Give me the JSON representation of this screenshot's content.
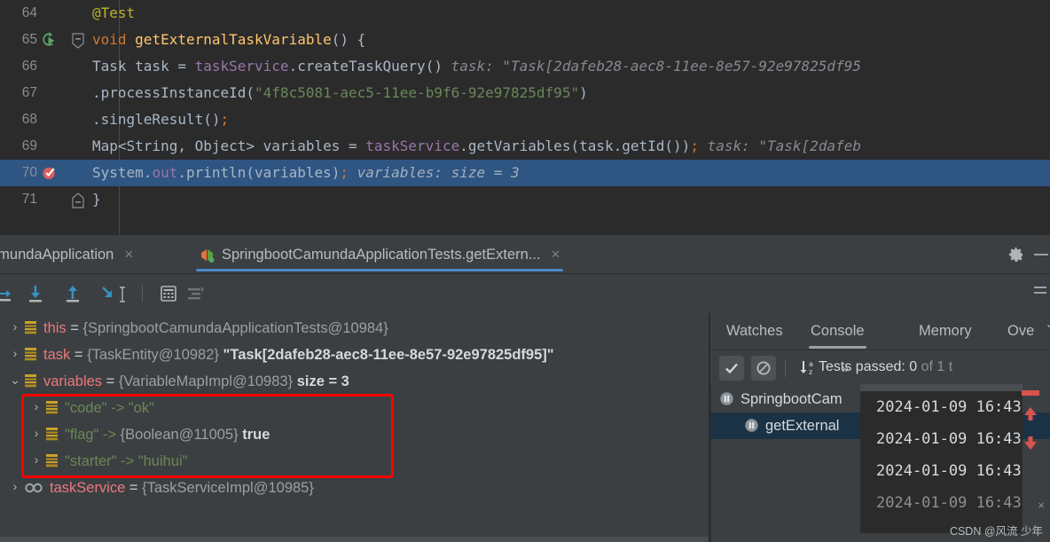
{
  "editor": {
    "lines": [
      {
        "number": "64",
        "gutter": "",
        "fold": false,
        "highlighted": false,
        "tokens": [
          {
            "text": "    ",
            "cls": "k-plain"
          },
          {
            "text": "@Test",
            "cls": "k-annot"
          }
        ]
      },
      {
        "number": "65",
        "gutter": "run-icon",
        "fold": true,
        "highlighted": false,
        "tokens": [
          {
            "text": "    ",
            "cls": "k-plain"
          },
          {
            "text": "void",
            "cls": "k-kw"
          },
          {
            "text": " ",
            "cls": "k-plain"
          },
          {
            "text": "getExternalTaskVariable",
            "cls": "k-meth"
          },
          {
            "text": "() {",
            "cls": "k-plain"
          }
        ]
      },
      {
        "number": "66",
        "gutter": "",
        "fold": false,
        "highlighted": false,
        "tokens": [
          {
            "text": "        Task task = ",
            "cls": "k-plain"
          },
          {
            "text": "taskService",
            "cls": "k-field"
          },
          {
            "text": ".createTaskQuery()",
            "cls": "k-plain"
          },
          {
            "text": "   task: \"Task[2dafeb28-aec8-11ee-8e57-92e97825df95",
            "cls": "k-hint"
          }
        ]
      },
      {
        "number": "67",
        "gutter": "",
        "fold": false,
        "highlighted": false,
        "tokens": [
          {
            "text": "                .processInstanceId(",
            "cls": "k-plain"
          },
          {
            "text": "\"4f8c5081-aec5-11ee-b9f6-92e97825df95\"",
            "cls": "k-str"
          },
          {
            "text": ")",
            "cls": "k-plain"
          }
        ]
      },
      {
        "number": "68",
        "gutter": "",
        "fold": false,
        "highlighted": false,
        "tokens": [
          {
            "text": "                .singleResult()",
            "cls": "k-plain"
          },
          {
            "text": ";",
            "cls": "k-semi"
          }
        ]
      },
      {
        "number": "69",
        "gutter": "",
        "fold": false,
        "highlighted": false,
        "tokens": [
          {
            "text": "        Map<String, Object> variables = ",
            "cls": "k-plain"
          },
          {
            "text": "taskService",
            "cls": "k-field"
          },
          {
            "text": ".getVariables(task.getId())",
            "cls": "k-plain"
          },
          {
            "text": ";",
            "cls": "k-semi"
          },
          {
            "text": "   task: \"Task[2dafeb",
            "cls": "k-hint"
          }
        ]
      },
      {
        "number": "70",
        "gutter": "breakpoint-verified-icon",
        "fold": false,
        "highlighted": true,
        "tokens": [
          {
            "text": "        System.",
            "cls": "k-plain"
          },
          {
            "text": "out",
            "cls": "k-field"
          },
          {
            "text": ".println(variables)",
            "cls": "k-plain"
          },
          {
            "text": ";",
            "cls": "k-semi"
          },
          {
            "text": "   variables:  size = 3",
            "cls": "k-hint-lt"
          }
        ]
      },
      {
        "number": "71",
        "gutter": "",
        "fold": true,
        "highlighted": false,
        "tokens": [
          {
            "text": "    }",
            "cls": "k-plain"
          }
        ]
      }
    ]
  },
  "tabbar": {
    "tabs": [
      {
        "label": "amundaApplication",
        "icon": "",
        "close": "×",
        "active": false
      },
      {
        "label": "SpringbootCamundaApplicationTests.getExtern...",
        "icon": "test-run-icon",
        "close": "×",
        "active": true
      }
    ],
    "settings_icon": "gear-icon",
    "hide_icon": "minimize-icon"
  },
  "debug_toolbar": {
    "buttons": [
      {
        "name": "step-over-button",
        "glyph": "step-over"
      },
      {
        "name": "step-into-button",
        "glyph": "step-into"
      },
      {
        "name": "step-out-button",
        "glyph": "step-out"
      },
      {
        "name": "force-step-into-button",
        "glyph": "force-step-into"
      },
      {
        "name": "evaluate-expression-button",
        "glyph": "calculator"
      },
      {
        "name": "settings-list-button",
        "glyph": "list-lines"
      }
    ]
  },
  "variables": {
    "rows": [
      {
        "indent": 0,
        "chevron": "›",
        "icon": "field-icon",
        "name": "this",
        "name_cls": "var-name",
        "eq": " = ",
        "type": "{SpringbootCamundaApplicationTests@10984}",
        "value": "",
        "boxed": false
      },
      {
        "indent": 0,
        "chevron": "›",
        "icon": "field-icon",
        "name": "task",
        "name_cls": "var-name",
        "eq": " = ",
        "type": "{TaskEntity@10982}",
        "value": "\"Task[2dafeb28-aec8-11ee-8e57-92e97825df95]\"",
        "boxed": false
      },
      {
        "indent": 0,
        "chevron": "⌄",
        "icon": "field-icon",
        "name": "variables",
        "name_cls": "var-name",
        "eq": " = ",
        "type": "{VariableMapImpl@10983}",
        "value": "size = 3",
        "boxed": false
      },
      {
        "indent": 1,
        "chevron": "›",
        "icon": "field-icon",
        "name": "\"code\" -> \"ok\"",
        "name_cls": "var-name-str",
        "eq": "",
        "type": "",
        "value": "",
        "boxed": true
      },
      {
        "indent": 1,
        "chevron": "›",
        "icon": "field-icon",
        "name": "\"flag\" -> ",
        "name_cls": "var-name-str",
        "eq": "",
        "type": "{Boolean@11005}",
        "value": "true",
        "boxed": true
      },
      {
        "indent": 1,
        "chevron": "›",
        "icon": "field-icon",
        "name": "\"starter\" -> \"huihui\"",
        "name_cls": "var-name-str",
        "eq": "",
        "type": "",
        "value": "",
        "boxed": true
      },
      {
        "indent": 0,
        "chevron": "›",
        "icon": "interface-icon",
        "name": "taskService",
        "name_cls": "var-name",
        "eq": " = ",
        "type": "{TaskServiceImpl@10985}",
        "value": "",
        "boxed": false
      }
    ],
    "highlight_color": "#ff0000"
  },
  "right_panel": {
    "tabs": [
      {
        "label": "Watches",
        "active": false
      },
      {
        "label": "Console",
        "active": true
      },
      {
        "label": "Memory",
        "active": false
      },
      {
        "label": "Ove",
        "active": false
      }
    ],
    "overflow_chevron": "ˇ",
    "toolbar": {
      "show_passed_label": "show-passed-icon",
      "hide_ignored_label": "hide-ignored-icon",
      "sort_label": "sort-alphabetically-icon",
      "expand_label": "»"
    },
    "status": {
      "prefix": "Tests passed: ",
      "count": "0",
      "suffix": " of 1 t"
    },
    "tree": [
      {
        "label": "SpringbootCam",
        "indent": 0,
        "selected": false,
        "icon": "paused-icon"
      },
      {
        "label": "getExternal",
        "indent": 1,
        "selected": true,
        "icon": "paused-icon"
      }
    ]
  },
  "console_popup": {
    "lines": [
      {
        "text": "2024-01-09 16:43",
        "dim": false
      },
      {
        "text": "2024-01-09 16:43",
        "dim": false
      },
      {
        "text": "2024-01-09 16:43",
        "dim": false
      },
      {
        "text": "2024-01-09 16:43",
        "dim": true
      }
    ]
  },
  "watermark": "CSDN @风流 少年",
  "colors": {
    "editor_bg": "#2b2b2b",
    "panel_bg": "#3c3f41",
    "selection": "#2f5582",
    "accent": "#4a88c7",
    "annotation": "#bbb529",
    "keyword": "#cc7832",
    "method": "#ffc66d",
    "field": "#9876aa",
    "string": "#6a8759",
    "red_box": "#ff0000",
    "tree_selected": "#1b3244"
  }
}
